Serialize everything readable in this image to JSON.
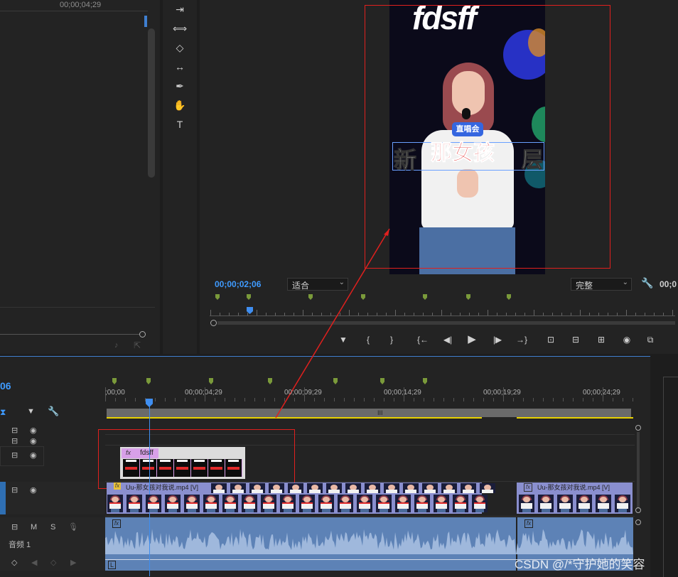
{
  "source_panel": {
    "timecode": "00;00;04;29"
  },
  "tools": [
    {
      "icon": "track-select-forward-icon",
      "glyph": "⇥"
    },
    {
      "icon": "ripple-edit-icon",
      "glyph": "⟺"
    },
    {
      "icon": "razor-icon",
      "glyph": "◇"
    },
    {
      "icon": "slip-icon",
      "glyph": "↔"
    },
    {
      "icon": "pen-icon",
      "glyph": "✒"
    },
    {
      "icon": "hand-icon",
      "glyph": "✋"
    },
    {
      "icon": "type-icon",
      "glyph": "T"
    }
  ],
  "program": {
    "title_text": "fdsff",
    "caption_main": "那女孩",
    "caption_left": "新",
    "caption_right": "层",
    "badge": "直唱会",
    "timecode": "00;00;02;06",
    "fit_option": "适合",
    "quality_option": "完整",
    "end_timecode": "00;0"
  },
  "transport": [
    {
      "name": "add-marker-icon",
      "glyph": "▼"
    },
    {
      "name": "mark-in-icon",
      "glyph": "{"
    },
    {
      "name": "mark-out-icon",
      "glyph": "}"
    },
    {
      "name": "go-to-in-icon",
      "glyph": "{←"
    },
    {
      "name": "step-back-icon",
      "glyph": "◀|"
    },
    {
      "name": "play-icon",
      "glyph": "▶"
    },
    {
      "name": "step-forward-icon",
      "glyph": "|▶"
    },
    {
      "name": "go-to-out-icon",
      "glyph": "→}"
    },
    {
      "name": "lift-icon",
      "glyph": "⊡"
    },
    {
      "name": "extract-icon",
      "glyph": "⊟"
    },
    {
      "name": "insert-icon",
      "glyph": "⊞"
    },
    {
      "name": "export-frame-icon",
      "glyph": "◉"
    },
    {
      "name": "compare-icon",
      "glyph": "⧉"
    }
  ],
  "timeline": {
    "timecode": "06",
    "ruler_labels": [
      ";00;00",
      "00;00;04;29",
      "00;00;09;29",
      "00;00;14;29",
      "00;00;19;29",
      "00;00;24;29"
    ],
    "nest_clip_label": "fdsff",
    "video_clip_label": "Uu-那女孩对我说.mp4 [V]",
    "video_clip2_label": "Uu-那女孩对我说.mp4 [V]",
    "audio_track_name": "音频 1",
    "audio_buttons": [
      "M",
      "S"
    ]
  },
  "watermark": "CSDN @/*守护她的笑容",
  "colors": {
    "accent_blue": "#3f9bff",
    "annotation_red": "#e0201e",
    "marker_green": "#7a9a3a",
    "work_area_yellow": "#e8d100",
    "clip_video": "#8a8fcf",
    "clip_nest": "#d8a0e8",
    "audio_waveform": "#6f93c7"
  }
}
